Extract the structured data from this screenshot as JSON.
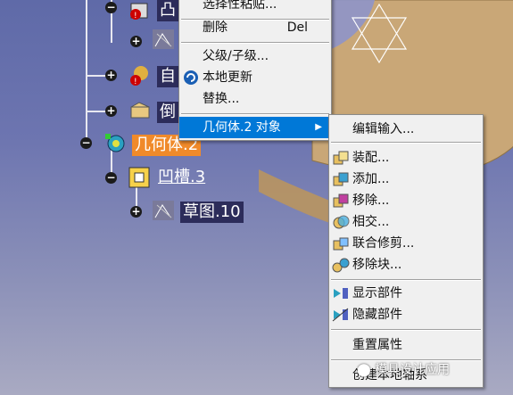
{
  "tree": {
    "nodes": [
      {
        "id": "top-partial",
        "label": "凸",
        "style": "dark"
      },
      {
        "id": "auto",
        "label": "自",
        "style": "dark"
      },
      {
        "id": "chamfer",
        "label": "倒",
        "style": "dark"
      },
      {
        "id": "body",
        "label": "几何体.2",
        "style": "selected"
      },
      {
        "id": "groove",
        "label": "凹槽.3",
        "style": "underlined"
      },
      {
        "id": "sketch",
        "label": "草图.10",
        "style": "dark"
      }
    ]
  },
  "context_menu": {
    "items": [
      {
        "label": "选择性粘贴...",
        "shortcut": ""
      },
      {
        "label": "删除",
        "shortcut": "Del"
      },
      {
        "label": "父级/子级...",
        "shortcut": ""
      },
      {
        "label": "本地更新",
        "shortcut": ""
      },
      {
        "label": "替换...",
        "shortcut": ""
      },
      {
        "label": "几何体.2 对象",
        "shortcut": ""
      }
    ]
  },
  "submenu": {
    "items": [
      {
        "label": "编辑输入..."
      },
      {
        "label": "装配..."
      },
      {
        "label": "添加..."
      },
      {
        "label": "移除..."
      },
      {
        "label": "相交..."
      },
      {
        "label": "联合修剪..."
      },
      {
        "label": "移除块..."
      },
      {
        "label": "显示部件"
      },
      {
        "label": "隐藏部件"
      },
      {
        "label": "重置属性"
      },
      {
        "label": "创建本地轴系"
      }
    ]
  },
  "watermark": {
    "text": "模具设计应用"
  },
  "colors": {
    "highlight": "#0078d7",
    "selected_node": "#f08a2a",
    "part_fill": "#c9a777"
  }
}
